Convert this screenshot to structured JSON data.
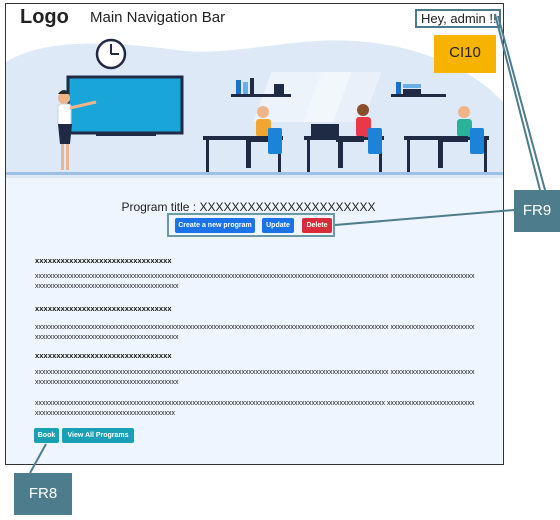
{
  "navbar": {
    "logo": "Logo",
    "title": "Main Navigation Bar",
    "greeting": "Hey, admin !!"
  },
  "program": {
    "title": "Program title : XXXXXXXXXXXXXXXXXXXXXX",
    "buttons": {
      "create": "Create a new program",
      "update": "Update",
      "delete": "Delete"
    }
  },
  "sections": [
    {
      "heading": "xxxxxxxxxxxxxxxxxxxxxxxxxxxxxxxx",
      "body": "xxxxxxxxxxxxxxxxxxxxxxxxxxxxxxxxxxxxxxxxxxxxxxxxxxxxxxxxxxxxxxxxxxxxxxxxxxxxxxxxxxxxxxxxxxxxxxxxxxxxx xxxxxxxxxxxxxxxxxxxxxxxxxxxxxxxxxxxxxxxxxxxxxxxxxxxxxxxxxxxxxxxxx"
    },
    {
      "heading": "xxxxxxxxxxxxxxxxxxxxxxxxxxxxxxxx",
      "body": "xxxxxxxxxxxxxxxxxxxxxxxxxxxxxxxxxxxxxxxxxxxxxxxxxxxxxxxxxxxxxxxxxxxxxxxxxxxxxxxxxxxxxxxxxxxxxxxxxxxxx xxxxxxxxxxxxxxxxxxxxxxxxxxxxxxxxxxxxxxxxxxxxxxxxxxxxxxxxxxxxxxxxx"
    },
    {
      "heading": "xxxxxxxxxxxxxxxxxxxxxxxxxxxxxxxx",
      "body": "xxxxxxxxxxxxxxxxxxxxxxxxxxxxxxxxxxxxxxxxxxxxxxxxxxxxxxxxxxxxxxxxxxxxxxxxxxxxxxxxxxxxxxxxxxxxxxxxxxxxx xxxxxxxxxxxxxxxxxxxxxxxxxxxxxxxxxxxxxxxxxxxxxxxxxxxxxxxxxxxxxxxxx"
    },
    {
      "heading": "",
      "body": "xxxxxxxxxxxxxxxxxxxxxxxxxxxxxxxxxxxxxxxxxxxxxxxxxxxxxxxxxxxxxxxxxxxxxxxxxxxxxxxxxxxxxxxxxxxxxxxxxxxx xxxxxxxxxxxxxxxxxxxxxxxxxxxxxxxxxxxxxxxxxxxxxxxxxxxxxxxxxxxxxxxxx"
    }
  ],
  "footer_buttons": {
    "book": "Book",
    "view_all": "View All Programs"
  },
  "annotations": {
    "ci10": "CI10",
    "fr9": "FR9",
    "fr8": "FR8"
  },
  "colors": {
    "primary_button": "#1a73e8",
    "danger_button": "#d92c3a",
    "info_button": "#1aa0b4",
    "annotation_teal": "#4d7c8c",
    "annotation_yellow": "#f6b400"
  },
  "illustration": {
    "scene": "classroom-illustration"
  }
}
